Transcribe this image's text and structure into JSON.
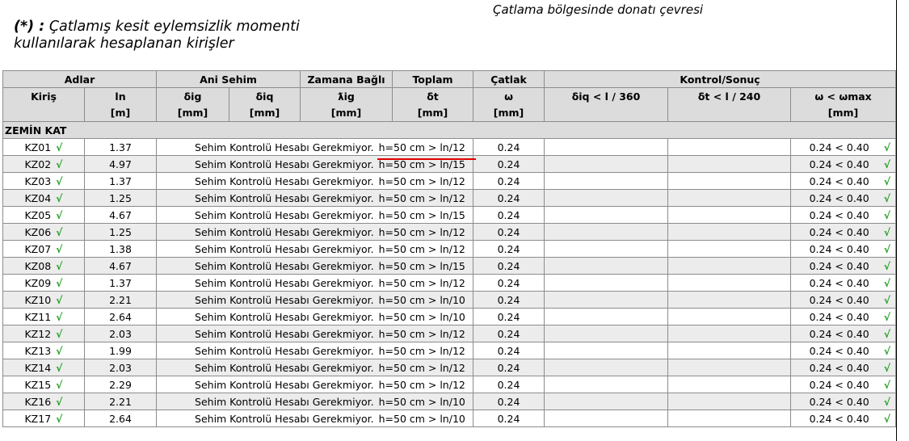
{
  "top_note": "Çatlama bölgesinde donatı çevresi",
  "heading": {
    "mark": "(*) :",
    "line1": "Çatlamış kesit eylemsizlik momenti",
    "line2": "kullanılarak hesaplanan kirişler"
  },
  "table": {
    "groups": {
      "adlar": "Adlar",
      "ani_sehim": "Ani Sehim",
      "zamana_bagli": "Zamana Bağlı",
      "toplam": "Toplam",
      "catlak": "Çatlak",
      "kontrol": "Kontrol/Sonuç"
    },
    "columns": {
      "kiris": "Kiriş",
      "ln": "ln",
      "dig": "δig",
      "diq": "δiq",
      "lig": "ƛig",
      "dt": "δt",
      "w": "ω",
      "c1": "δiq < l / 360",
      "c2": "δt < l / 240",
      "c3": "ω < ωmax"
    },
    "units": {
      "ln": "[m]",
      "dig": "[mm]",
      "diq": "[mm]",
      "lig": "[mm]",
      "dt": "[mm]",
      "w": "[mm]",
      "c3": "[mm]"
    },
    "section": "ZEMİN KAT",
    "check_mark": "√",
    "message": "Sehim Kontrolü Hesabı Gerekmiyor.",
    "rows": [
      {
        "name": "KZ01",
        "ln": "1.37",
        "cond": "h=50 cm > ln/12",
        "w": "0.24",
        "ctrl": "0.24 < 0.40"
      },
      {
        "name": "KZ02",
        "ln": "4.97",
        "cond": "h=50 cm > ln/15",
        "w": "0.24",
        "ctrl": "0.24 < 0.40"
      },
      {
        "name": "KZ03",
        "ln": "1.37",
        "cond": "h=50 cm > ln/12",
        "w": "0.24",
        "ctrl": "0.24 < 0.40"
      },
      {
        "name": "KZ04",
        "ln": "1.25",
        "cond": "h=50 cm > ln/12",
        "w": "0.24",
        "ctrl": "0.24 < 0.40"
      },
      {
        "name": "KZ05",
        "ln": "4.67",
        "cond": "h=50 cm > ln/15",
        "w": "0.24",
        "ctrl": "0.24 < 0.40"
      },
      {
        "name": "KZ06",
        "ln": "1.25",
        "cond": "h=50 cm > ln/12",
        "w": "0.24",
        "ctrl": "0.24 < 0.40"
      },
      {
        "name": "KZ07",
        "ln": "1.38",
        "cond": "h=50 cm > ln/12",
        "w": "0.24",
        "ctrl": "0.24 < 0.40"
      },
      {
        "name": "KZ08",
        "ln": "4.67",
        "cond": "h=50 cm > ln/15",
        "w": "0.24",
        "ctrl": "0.24 < 0.40"
      },
      {
        "name": "KZ09",
        "ln": "1.37",
        "cond": "h=50 cm > ln/12",
        "w": "0.24",
        "ctrl": "0.24 < 0.40"
      },
      {
        "name": "KZ10",
        "ln": "2.21",
        "cond": "h=50 cm > ln/10",
        "w": "0.24",
        "ctrl": "0.24 < 0.40"
      },
      {
        "name": "KZ11",
        "ln": "2.64",
        "cond": "h=50 cm > ln/10",
        "w": "0.24",
        "ctrl": "0.24 < 0.40"
      },
      {
        "name": "KZ12",
        "ln": "2.03",
        "cond": "h=50 cm > ln/12",
        "w": "0.24",
        "ctrl": "0.24 < 0.40"
      },
      {
        "name": "KZ13",
        "ln": "1.99",
        "cond": "h=50 cm > ln/12",
        "w": "0.24",
        "ctrl": "0.24 < 0.40"
      },
      {
        "name": "KZ14",
        "ln": "2.03",
        "cond": "h=50 cm > ln/12",
        "w": "0.24",
        "ctrl": "0.24 < 0.40"
      },
      {
        "name": "KZ15",
        "ln": "2.29",
        "cond": "h=50 cm > ln/12",
        "w": "0.24",
        "ctrl": "0.24 < 0.40"
      },
      {
        "name": "KZ16",
        "ln": "2.21",
        "cond": "h=50 cm > ln/10",
        "w": "0.24",
        "ctrl": "0.24 < 0.40"
      },
      {
        "name": "KZ17",
        "ln": "2.64",
        "cond": "h=50 cm > ln/10",
        "w": "0.24",
        "ctrl": "0.24 < 0.40"
      }
    ]
  },
  "colors": {
    "header_bg": "#dcdcdc",
    "row_alt_bg": "#ececec",
    "check": "#22a022",
    "highlight_line": "#e00000"
  }
}
